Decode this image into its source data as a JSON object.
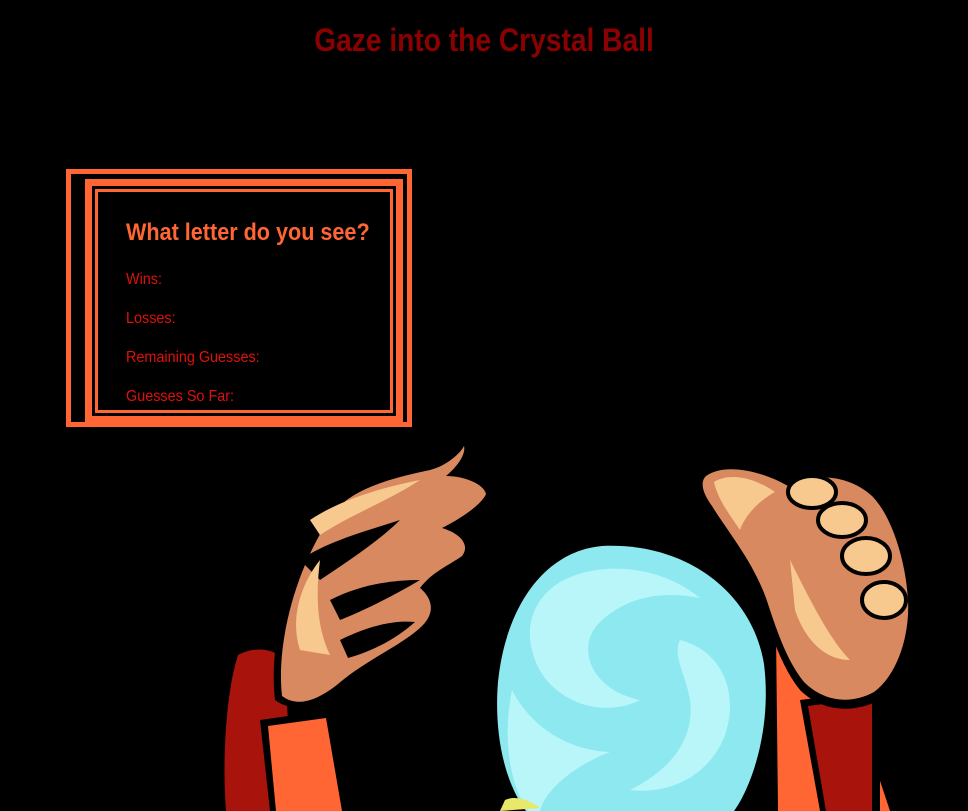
{
  "header": {
    "title": "Gaze into the Crystal Ball"
  },
  "game_panel": {
    "prompt": "What letter do you see?",
    "stats": [
      {
        "label": "Wins:",
        "value": ""
      },
      {
        "label": "Losses:",
        "value": ""
      },
      {
        "label": "Remaining Guesses:",
        "value": ""
      },
      {
        "label": "Guesses So Far:",
        "value": ""
      }
    ]
  },
  "colors": {
    "background": "#000000",
    "title": "#8b0000",
    "panel_border": "#ff6633",
    "prompt": "#ff6633",
    "stat_text": "#e0100a",
    "crystal_ball": "#8ee8ef",
    "skin": "#d9895f",
    "sleeve": "#a8140c"
  },
  "illustration": {
    "icon": "fortune-teller-crystal-ball-icon"
  }
}
